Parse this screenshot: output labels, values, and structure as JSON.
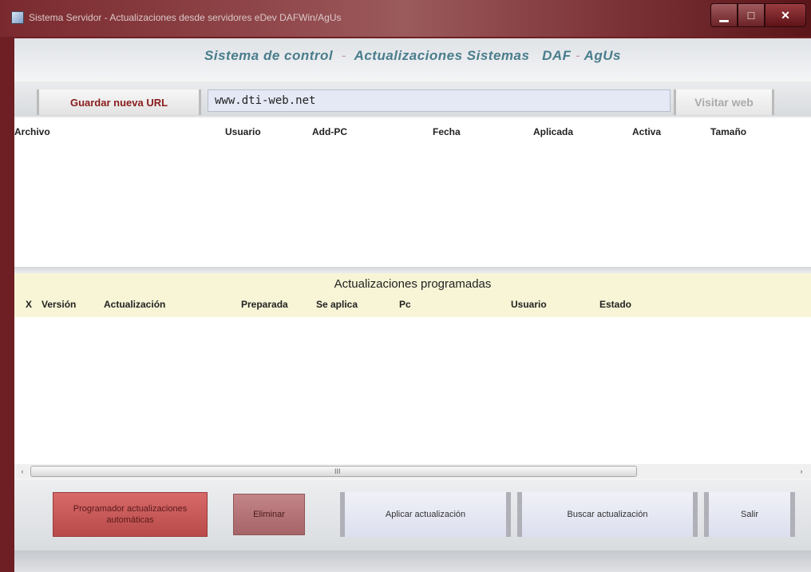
{
  "window": {
    "title": "Sistema Servidor - Actualizaciones desde servidores eDev DAFWin/AgUs",
    "controls": {
      "minimize_icon": "minimize-icon",
      "maximize_icon": "maximize-icon",
      "close_icon": "close-icon"
    }
  },
  "header": {
    "part1": "Sistema de control",
    "sep1": "-",
    "part2": "Actualizaciones Sistemas",
    "part3": "DAF",
    "sep2": "-",
    "part4": "AgUs"
  },
  "url_row": {
    "save_label": "Guardar nueva URL",
    "url_value": "www.dti-web.net",
    "visit_label": "Visitar web"
  },
  "files_table": {
    "columns": [
      "Archivo",
      "Usuario",
      "Add-PC",
      "Fecha",
      "Aplicada",
      "Activa",
      "Tamaño"
    ],
    "rows": []
  },
  "scheduled": {
    "title": "Actualizaciones programadas",
    "columns": [
      "X",
      "Versión",
      "Actualización",
      "Preparada",
      "Se aplica",
      "Pc",
      "Usuario",
      "Estado"
    ],
    "rows": []
  },
  "scrollbar": {
    "left_arrow": "‹",
    "right_arrow": "›",
    "grip": "III"
  },
  "buttons": {
    "programador": "Programador actualizaciones automáticas",
    "eliminar": "Eliminar",
    "aplicar": "Aplicar actualización",
    "buscar": "Buscar actualización",
    "salir": "Salir"
  },
  "colors": {
    "window_frame": "#6e1f24",
    "header_text": "#4a7d8c",
    "save_text": "#8a1c1c",
    "sched_bg": "#f7f5d6",
    "programador_bg": "#c95a5a",
    "eliminar_bg": "#b47478"
  }
}
